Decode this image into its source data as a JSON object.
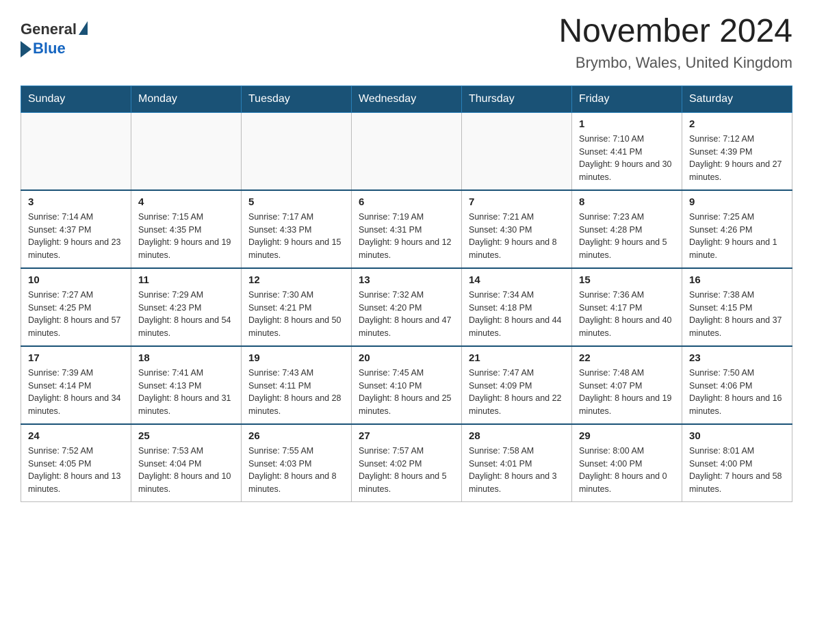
{
  "header": {
    "logo_general": "General",
    "logo_blue": "Blue",
    "title": "November 2024",
    "subtitle": "Brymbo, Wales, United Kingdom"
  },
  "days_of_week": [
    "Sunday",
    "Monday",
    "Tuesday",
    "Wednesday",
    "Thursday",
    "Friday",
    "Saturday"
  ],
  "weeks": [
    {
      "days": [
        {
          "number": "",
          "sunrise": "",
          "sunset": "",
          "daylight": "",
          "empty": true
        },
        {
          "number": "",
          "sunrise": "",
          "sunset": "",
          "daylight": "",
          "empty": true
        },
        {
          "number": "",
          "sunrise": "",
          "sunset": "",
          "daylight": "",
          "empty": true
        },
        {
          "number": "",
          "sunrise": "",
          "sunset": "",
          "daylight": "",
          "empty": true
        },
        {
          "number": "",
          "sunrise": "",
          "sunset": "",
          "daylight": "",
          "empty": true
        },
        {
          "number": "1",
          "sunrise": "Sunrise: 7:10 AM",
          "sunset": "Sunset: 4:41 PM",
          "daylight": "Daylight: 9 hours and 30 minutes.",
          "empty": false
        },
        {
          "number": "2",
          "sunrise": "Sunrise: 7:12 AM",
          "sunset": "Sunset: 4:39 PM",
          "daylight": "Daylight: 9 hours and 27 minutes.",
          "empty": false
        }
      ]
    },
    {
      "days": [
        {
          "number": "3",
          "sunrise": "Sunrise: 7:14 AM",
          "sunset": "Sunset: 4:37 PM",
          "daylight": "Daylight: 9 hours and 23 minutes.",
          "empty": false
        },
        {
          "number": "4",
          "sunrise": "Sunrise: 7:15 AM",
          "sunset": "Sunset: 4:35 PM",
          "daylight": "Daylight: 9 hours and 19 minutes.",
          "empty": false
        },
        {
          "number": "5",
          "sunrise": "Sunrise: 7:17 AM",
          "sunset": "Sunset: 4:33 PM",
          "daylight": "Daylight: 9 hours and 15 minutes.",
          "empty": false
        },
        {
          "number": "6",
          "sunrise": "Sunrise: 7:19 AM",
          "sunset": "Sunset: 4:31 PM",
          "daylight": "Daylight: 9 hours and 12 minutes.",
          "empty": false
        },
        {
          "number": "7",
          "sunrise": "Sunrise: 7:21 AM",
          "sunset": "Sunset: 4:30 PM",
          "daylight": "Daylight: 9 hours and 8 minutes.",
          "empty": false
        },
        {
          "number": "8",
          "sunrise": "Sunrise: 7:23 AM",
          "sunset": "Sunset: 4:28 PM",
          "daylight": "Daylight: 9 hours and 5 minutes.",
          "empty": false
        },
        {
          "number": "9",
          "sunrise": "Sunrise: 7:25 AM",
          "sunset": "Sunset: 4:26 PM",
          "daylight": "Daylight: 9 hours and 1 minute.",
          "empty": false
        }
      ]
    },
    {
      "days": [
        {
          "number": "10",
          "sunrise": "Sunrise: 7:27 AM",
          "sunset": "Sunset: 4:25 PM",
          "daylight": "Daylight: 8 hours and 57 minutes.",
          "empty": false
        },
        {
          "number": "11",
          "sunrise": "Sunrise: 7:29 AM",
          "sunset": "Sunset: 4:23 PM",
          "daylight": "Daylight: 8 hours and 54 minutes.",
          "empty": false
        },
        {
          "number": "12",
          "sunrise": "Sunrise: 7:30 AM",
          "sunset": "Sunset: 4:21 PM",
          "daylight": "Daylight: 8 hours and 50 minutes.",
          "empty": false
        },
        {
          "number": "13",
          "sunrise": "Sunrise: 7:32 AM",
          "sunset": "Sunset: 4:20 PM",
          "daylight": "Daylight: 8 hours and 47 minutes.",
          "empty": false
        },
        {
          "number": "14",
          "sunrise": "Sunrise: 7:34 AM",
          "sunset": "Sunset: 4:18 PM",
          "daylight": "Daylight: 8 hours and 44 minutes.",
          "empty": false
        },
        {
          "number": "15",
          "sunrise": "Sunrise: 7:36 AM",
          "sunset": "Sunset: 4:17 PM",
          "daylight": "Daylight: 8 hours and 40 minutes.",
          "empty": false
        },
        {
          "number": "16",
          "sunrise": "Sunrise: 7:38 AM",
          "sunset": "Sunset: 4:15 PM",
          "daylight": "Daylight: 8 hours and 37 minutes.",
          "empty": false
        }
      ]
    },
    {
      "days": [
        {
          "number": "17",
          "sunrise": "Sunrise: 7:39 AM",
          "sunset": "Sunset: 4:14 PM",
          "daylight": "Daylight: 8 hours and 34 minutes.",
          "empty": false
        },
        {
          "number": "18",
          "sunrise": "Sunrise: 7:41 AM",
          "sunset": "Sunset: 4:13 PM",
          "daylight": "Daylight: 8 hours and 31 minutes.",
          "empty": false
        },
        {
          "number": "19",
          "sunrise": "Sunrise: 7:43 AM",
          "sunset": "Sunset: 4:11 PM",
          "daylight": "Daylight: 8 hours and 28 minutes.",
          "empty": false
        },
        {
          "number": "20",
          "sunrise": "Sunrise: 7:45 AM",
          "sunset": "Sunset: 4:10 PM",
          "daylight": "Daylight: 8 hours and 25 minutes.",
          "empty": false
        },
        {
          "number": "21",
          "sunrise": "Sunrise: 7:47 AM",
          "sunset": "Sunset: 4:09 PM",
          "daylight": "Daylight: 8 hours and 22 minutes.",
          "empty": false
        },
        {
          "number": "22",
          "sunrise": "Sunrise: 7:48 AM",
          "sunset": "Sunset: 4:07 PM",
          "daylight": "Daylight: 8 hours and 19 minutes.",
          "empty": false
        },
        {
          "number": "23",
          "sunrise": "Sunrise: 7:50 AM",
          "sunset": "Sunset: 4:06 PM",
          "daylight": "Daylight: 8 hours and 16 minutes.",
          "empty": false
        }
      ]
    },
    {
      "days": [
        {
          "number": "24",
          "sunrise": "Sunrise: 7:52 AM",
          "sunset": "Sunset: 4:05 PM",
          "daylight": "Daylight: 8 hours and 13 minutes.",
          "empty": false
        },
        {
          "number": "25",
          "sunrise": "Sunrise: 7:53 AM",
          "sunset": "Sunset: 4:04 PM",
          "daylight": "Daylight: 8 hours and 10 minutes.",
          "empty": false
        },
        {
          "number": "26",
          "sunrise": "Sunrise: 7:55 AM",
          "sunset": "Sunset: 4:03 PM",
          "daylight": "Daylight: 8 hours and 8 minutes.",
          "empty": false
        },
        {
          "number": "27",
          "sunrise": "Sunrise: 7:57 AM",
          "sunset": "Sunset: 4:02 PM",
          "daylight": "Daylight: 8 hours and 5 minutes.",
          "empty": false
        },
        {
          "number": "28",
          "sunrise": "Sunrise: 7:58 AM",
          "sunset": "Sunset: 4:01 PM",
          "daylight": "Daylight: 8 hours and 3 minutes.",
          "empty": false
        },
        {
          "number": "29",
          "sunrise": "Sunrise: 8:00 AM",
          "sunset": "Sunset: 4:00 PM",
          "daylight": "Daylight: 8 hours and 0 minutes.",
          "empty": false
        },
        {
          "number": "30",
          "sunrise": "Sunrise: 8:01 AM",
          "sunset": "Sunset: 4:00 PM",
          "daylight": "Daylight: 7 hours and 58 minutes.",
          "empty": false
        }
      ]
    }
  ]
}
